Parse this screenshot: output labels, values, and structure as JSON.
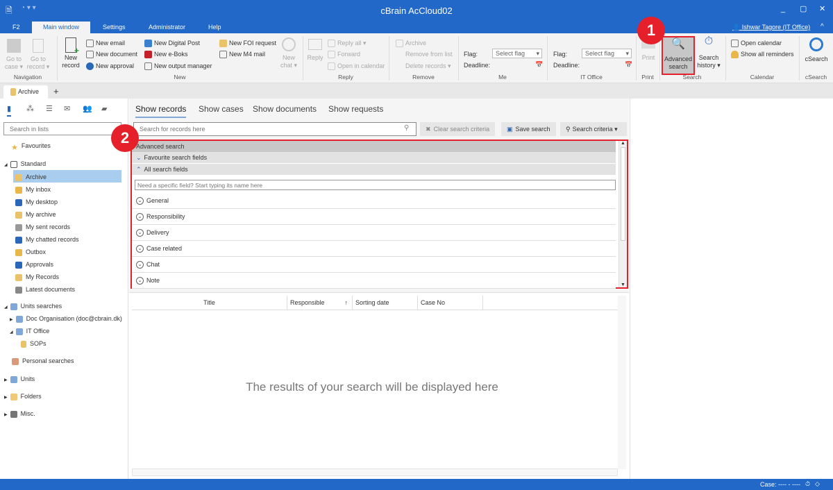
{
  "window": {
    "title": "cBrain AcCloud02",
    "user": "Ishwar Tagore (IT Office)"
  },
  "menu": [
    "F2",
    "Main window",
    "Settings",
    "Administrator",
    "Help"
  ],
  "ribbon": {
    "navigation": {
      "label": "Navigation",
      "go_case": "Go to case ▾",
      "go_record": "Go to record ▾"
    },
    "new": {
      "label": "New",
      "new_record": "New record",
      "items": [
        "New email",
        "New document",
        "New approval",
        "New Digital Post",
        "New e-Boks",
        "New output manager",
        "New FOI request",
        "New M4 mail"
      ],
      "new_chat": "New chat ▾"
    },
    "reply": {
      "label": "Reply",
      "reply": "Reply",
      "items": [
        "Reply all ▾",
        "Forward",
        "Open in calendar"
      ]
    },
    "remove": {
      "label": "Remove",
      "items": [
        "Archive",
        "Remove from list",
        "Delete records ▾"
      ]
    },
    "me": {
      "label": "Me",
      "flag": "Flag:",
      "deadline": "Deadline:",
      "select": "Select flag"
    },
    "it_office": {
      "label": "IT Office",
      "flag": "Flag:",
      "deadline": "Deadline:",
      "select": "Select flag"
    },
    "print": {
      "label": "Print",
      "print": "Print"
    },
    "search": {
      "label": "Search",
      "advanced": "Advanced search",
      "history": "Search history ▾"
    },
    "calendar": {
      "label": "Calendar",
      "open": "Open calendar",
      "reminders": "Show all reminders"
    },
    "csearch": {
      "label": "cSearch",
      "csearch": "cSearch"
    }
  },
  "doc_tab": "Archive",
  "left": {
    "search_placeholder": "Search in lists",
    "favourites": "Favourites",
    "standard": "Standard",
    "standard_items": [
      "Archive",
      "My inbox",
      "My desktop",
      "My archive",
      "My sent records",
      "My chatted records",
      "Outbox",
      "Approvals",
      "My Records",
      "Latest documents"
    ],
    "units_searches": "Units searches",
    "doc_org": "Doc Organisation (doc@cbrain.dk)",
    "it_office": "IT Office",
    "sops": "SOPs",
    "personal": "Personal searches",
    "units": "Units",
    "folders": "Folders",
    "misc": "Misc."
  },
  "main": {
    "tabs": [
      "Show records",
      "Show cases",
      "Show documents",
      "Show requests"
    ],
    "search_placeholder": "Search for records here",
    "clear": "Clear search criteria",
    "save": "Save search",
    "criteria": "Search criteria",
    "advanced": "Advanced search",
    "favourite_fields": "Favourite search fields",
    "all_fields": "All search fields",
    "field_placeholder": "Need a specific field? Start typing its name here",
    "categories": [
      "General",
      "Responsibility",
      "Delivery",
      "Case related",
      "Chat",
      "Note"
    ],
    "columns": [
      "Title",
      "Responsible",
      "Sorting date",
      "Case No"
    ],
    "empty": "The results of your search will be displayed here"
  },
  "badges": [
    "1",
    "2"
  ],
  "status": {
    "case": "Case: ---- - ----"
  },
  "colors": {
    "accent": "#2168c8",
    "highlight": "#e5202a",
    "selected": "#a9cdef"
  }
}
